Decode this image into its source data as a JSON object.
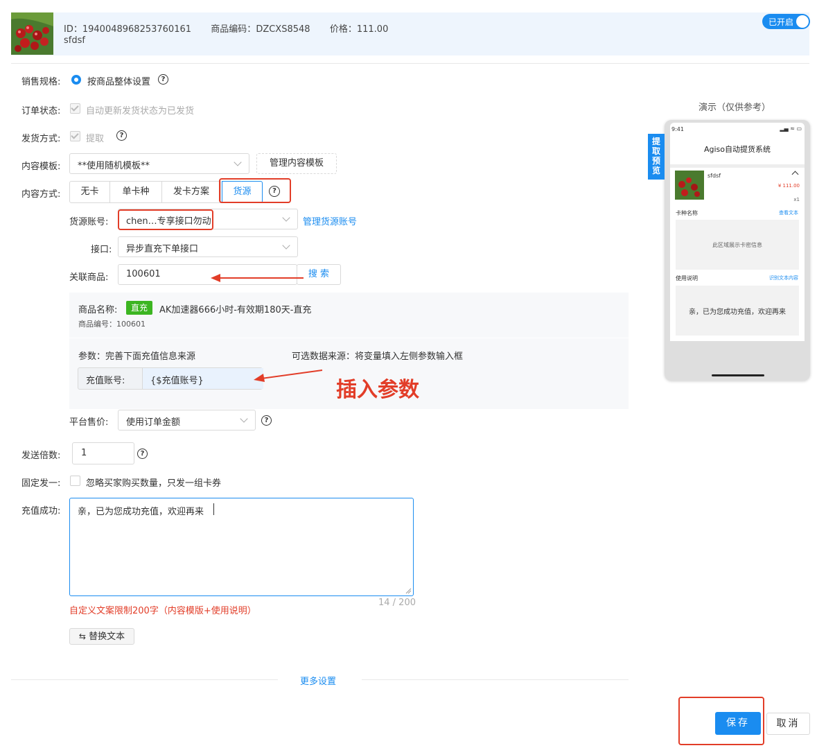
{
  "header": {
    "id_label": "ID：",
    "id_value": "1940048968253760161",
    "code_label": "商品编码：",
    "code_value": "DZCXS8548",
    "price_label": "价格：",
    "price_value": "111.00",
    "product_name": "sfdsf",
    "toggle_label": "已开启"
  },
  "form": {
    "sales_spec": {
      "label": "销售规格:",
      "option": "按商品整体设置"
    },
    "order_status": {
      "label": "订单状态:",
      "option": "自动更新发货状态为已发货"
    },
    "delivery_method": {
      "label": "发货方式:",
      "option": "提取"
    },
    "content_template": {
      "label": "内容模板:",
      "value": "**使用随机模板**",
      "manage_button": "管理内容模板"
    },
    "content_mode": {
      "label": "内容方式:",
      "tabs": [
        "无卡",
        "单卡种",
        "发卡方案",
        "货源"
      ],
      "active_tab": "货源"
    },
    "source_account": {
      "label": "货源账号:",
      "value": "chen…专享接口勿动",
      "manage_link": "管理货源账号"
    },
    "interface": {
      "label": "接口:",
      "value": "异步直充下单接口"
    },
    "linked_product": {
      "label": "关联商品:",
      "value": "100601",
      "search_button": "搜 索"
    },
    "product_info": {
      "name_label": "商品名称:",
      "tag": "直充",
      "name": "AK加速器666小时-有效期180天-直充",
      "code_text": "商品编号：100601"
    },
    "params": {
      "title": "参数：完善下面充值信息来源",
      "optional_source": "可选数据来源：将变量填入左侧参数输入框",
      "field_label": "充值账号:",
      "field_value": "{$充值账号}"
    },
    "platform_price": {
      "label": "平台售价:",
      "value": "使用订单金额"
    },
    "send_multiplier": {
      "label": "发送倍数:",
      "value": "1"
    },
    "fixed_one": {
      "label": "固定发一:",
      "option": "忽略买家购买数量，只发一组卡券"
    },
    "recharge_success": {
      "label": "充值成功:",
      "value": "亲，已为您成功充值，欢迎再来",
      "counter": "14 / 200",
      "error": "自定义文案限制200字（内容模版+使用说明）"
    },
    "replace_text_button": "替换文本",
    "more_settings": "更多设置"
  },
  "annotation": {
    "text": "插入参数"
  },
  "preview": {
    "title": "演示（仅供参考）",
    "side_tab": "提取预览",
    "time": "9:41",
    "app_title": "Agiso自动提货系统",
    "product_name": "sfdsf",
    "price": "¥ 111.00",
    "qty": "x1",
    "card_type_label": "卡种名称",
    "view_text_link": "查看文本",
    "card_area_text": "此区域展示卡密信息",
    "usage_label": "使用说明",
    "identify_link": "识别文本内容",
    "usage_text": "亲，已为您成功充值，欢迎再来"
  },
  "footer": {
    "save": "保存",
    "cancel": "取消"
  },
  "colors": {
    "primary": "#1a8cf0",
    "annotation_red": "#e23d28",
    "tag_green": "#3cb521"
  }
}
